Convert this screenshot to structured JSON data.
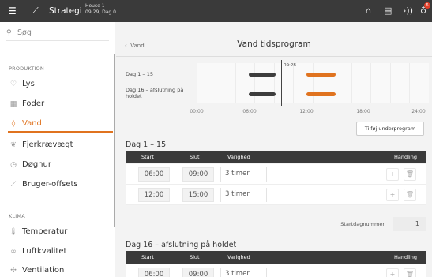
{
  "topbar": {
    "strategy_label": "Strategi",
    "house_name": "House 1",
    "house_info": "09:29, Dag 0",
    "notification_count": "6"
  },
  "sidebar": {
    "search_placeholder": "Søg",
    "sections": [
      {
        "label": "PRODUKTION",
        "items": [
          {
            "label": "Lys",
            "icon": "bulb-icon"
          },
          {
            "label": "Foder",
            "icon": "feed-icon"
          },
          {
            "label": "Vand",
            "icon": "drop-icon",
            "active": true
          },
          {
            "label": "Fjerkrævægt",
            "icon": "bird-icon"
          },
          {
            "label": "Døgnur",
            "icon": "clock-icon"
          },
          {
            "label": "Bruger-offsets",
            "icon": "offset-icon"
          }
        ]
      },
      {
        "label": "KLIMA",
        "items": [
          {
            "label": "Temperatur",
            "icon": "thermometer-icon"
          },
          {
            "label": "Luftkvalitet",
            "icon": "co2-icon"
          },
          {
            "label": "Ventilation",
            "icon": "fan-icon"
          }
        ]
      }
    ]
  },
  "main": {
    "back_label": "Vand",
    "title": "Vand tidsprogram",
    "timeline": {
      "rows": [
        "Dag 1 – 15",
        "Dag 16 – afslutning på holdet"
      ],
      "now_label": "09:28",
      "axis_ticks": [
        "00:00",
        "06:00",
        "12:00",
        "18:00",
        "24:00"
      ],
      "colors": {
        "dark": "#3d3d3d",
        "accent": "#e0731f"
      }
    },
    "add_program_button": "Tilføj underprogram",
    "table_headers": {
      "start": "Start",
      "end": "Slut",
      "duration": "Varighed",
      "action": "Handling"
    },
    "programs": [
      {
        "title": "Dag 1 – 15",
        "rows": [
          {
            "start": "06:00",
            "end": "09:00",
            "duration": "3 timer"
          },
          {
            "start": "12:00",
            "end": "15:00",
            "duration": "3 timer"
          }
        ],
        "start_day_label": "Startdagnummer",
        "start_day_value": "1"
      },
      {
        "title": "Dag 16 – afslutning på holdet",
        "rows": [
          {
            "start": "06:00",
            "end": "09:00",
            "duration": "3 timer"
          }
        ]
      }
    ]
  }
}
